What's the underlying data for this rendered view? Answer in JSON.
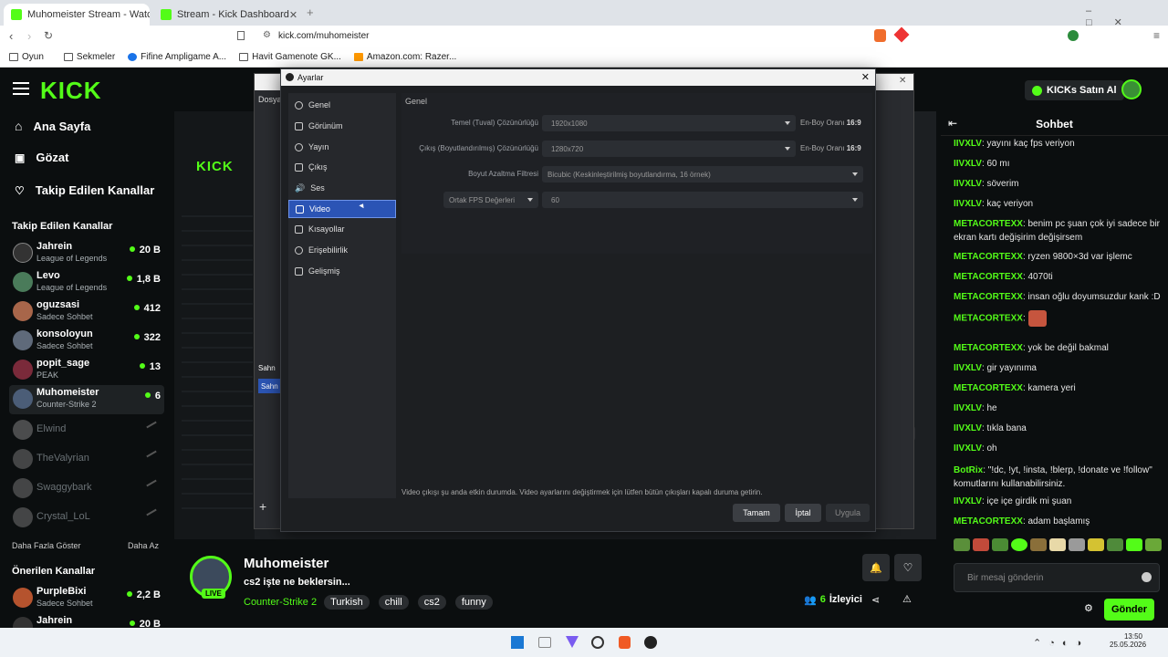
{
  "browser": {
    "tabs": [
      {
        "label": "Muhomeister Stream - Watch"
      },
      {
        "label": "Stream - Kick Dashboard"
      }
    ],
    "url": "kick.com/muhomeister",
    "bookmarks": [
      "Oyun",
      "Sekmeler",
      "Fifine Ampligame A...",
      "Havit Gamenote GK...",
      "Amazon.com: Razer..."
    ]
  },
  "kick": {
    "logo": "KICK",
    "buy_kicks": "KICKs Satın Al",
    "nav": [
      {
        "label": "Ana Sayfa",
        "icon": "home-icon"
      },
      {
        "label": "Gözat",
        "icon": "browse-icon"
      },
      {
        "label": "Takip Edilen Kanallar",
        "icon": "heart-icon"
      }
    ],
    "followed_title": "Takip Edilen Kanallar",
    "followed": [
      {
        "name": "Jahrein",
        "sub": "League of Legends",
        "viewers": "20 B",
        "live": true
      },
      {
        "name": "Levo",
        "sub": "League of Legends",
        "viewers": "1,8 B",
        "live": true
      },
      {
        "name": "oguzsasi",
        "sub": "Sadece Sohbet",
        "viewers": "412",
        "live": true
      },
      {
        "name": "konsoloyun",
        "sub": "Sadece Sohbet",
        "viewers": "322",
        "live": true
      },
      {
        "name": "popit_sage",
        "sub": "PEAK",
        "viewers": "13",
        "live": true
      },
      {
        "name": "Muhomeister",
        "sub": "Counter-Strike 2",
        "viewers": "6",
        "live": true
      },
      {
        "name": "Elwind",
        "live": false
      },
      {
        "name": "TheValyrian",
        "live": false
      },
      {
        "name": "Swaggybark",
        "live": false
      },
      {
        "name": "Crystal_LoL",
        "live": false
      }
    ],
    "show_more": "Daha Fazla Göster",
    "show_less": "Daha Az",
    "recommended_title": "Önerilen Kanallar",
    "recommended": [
      {
        "name": "PurpleBixi",
        "sub": "Sadece Sohbet",
        "viewers": "2,2 B"
      },
      {
        "name": "Jahrein",
        "viewers": "20 B"
      }
    ]
  },
  "obs": {
    "title": "Ayarlar",
    "sidebar": [
      "Genel",
      "Görünüm",
      "Yayın",
      "Çıkış",
      "Ses",
      "Video",
      "Kısayollar",
      "Erişebilirlik",
      "Gelişmiş"
    ],
    "selected": "Video",
    "section": "Genel",
    "rows": {
      "base_label": "Temel (Tuval) Çözünürlüğü",
      "base_value": "1920x1080",
      "out_label": "Çıkış (Boyutlandırılmış) Çözünürlüğü",
      "out_value": "1280x720",
      "ratio_label": "En-Boy Oranı",
      "ratio_value": "16:9",
      "filter_label": "Boyut Azaltma Filtresi",
      "filter_value": "Bicubic (Keskinleştirilmiş boyutlandırma, 16 örnek)",
      "fps_type": "Ortak FPS Değerleri",
      "fps_value": "60"
    },
    "warning": "Video çıkışı şu anda etkin durumda. Video ayarlarını değiştirmek için lütfen bütün çıkışları kapalı duruma getirin.",
    "buttons": {
      "ok": "Tamam",
      "cancel": "İptal",
      "apply": "Uygula"
    }
  },
  "stream": {
    "name": "Muhomeister",
    "title": "cs2 işte ne beklersin...",
    "category": "Counter-Strike 2",
    "tags": [
      "Turkish",
      "chill",
      "cs2",
      "funny"
    ],
    "live": "LIVE",
    "viewers": "6",
    "viewers_label": "İzleyici"
  },
  "chat": {
    "title": "Sohbet",
    "messages": [
      {
        "user": "IIVXLV",
        "text": "yayını kaç fps veriyon",
        "color": "#53fc18"
      },
      {
        "user": "IIVXLV",
        "text": "60 mı",
        "color": "#53fc18"
      },
      {
        "user": "IIVXLV",
        "text": "söverim",
        "color": "#53fc18"
      },
      {
        "user": "IIVXLV",
        "text": "kaç veriyon",
        "color": "#53fc18"
      },
      {
        "user": "METACORTEXX",
        "text": "benim pc şuan çok iyi sadece bir ekran kartı değişirim değişirsem",
        "color": "#53fc18"
      },
      {
        "user": "METACORTEXX",
        "text": "ryzen 9800×3d var işlemc",
        "color": "#53fc18"
      },
      {
        "user": "METACORTEXX",
        "text": "4070ti",
        "color": "#53fc18"
      },
      {
        "user": "METACORTEXX",
        "text": "insan oğlu doyumsuzdur kank :D",
        "color": "#53fc18"
      },
      {
        "user": "METACORTEXX",
        "text": "",
        "color": "#53fc18"
      },
      {
        "user": "METACORTEXX",
        "text": "yok be değil bakmal",
        "color": "#53fc18"
      },
      {
        "user": "IIVXLV",
        "text": "gir yayınıma",
        "color": "#53fc18"
      },
      {
        "user": "METACORTEXX",
        "text": "kamera yeri",
        "color": "#53fc18"
      },
      {
        "user": "IIVXLV",
        "text": "he",
        "color": "#53fc18"
      },
      {
        "user": "IIVXLV",
        "text": "tıkla bana",
        "color": "#53fc18"
      },
      {
        "user": "IIVXLV",
        "text": "oh",
        "color": "#53fc18"
      },
      {
        "user": "BotRix",
        "text": "\"!dc, !yt, !insta, !blerp, !donate ve !follow\" komutlarını kullanabilirsiniz.",
        "color": "#53fc18"
      },
      {
        "user": "IIVXLV",
        "text": "içe içe girdik mi şuan",
        "color": "#53fc18"
      },
      {
        "user": "METACORTEXX",
        "text": "adam başlamış",
        "color": "#53fc18"
      }
    ],
    "placeholder": "Bir mesaj gönderin",
    "send": "Gönder"
  },
  "taskbar": {
    "time": "13:50",
    "date": "25.05.2026"
  }
}
